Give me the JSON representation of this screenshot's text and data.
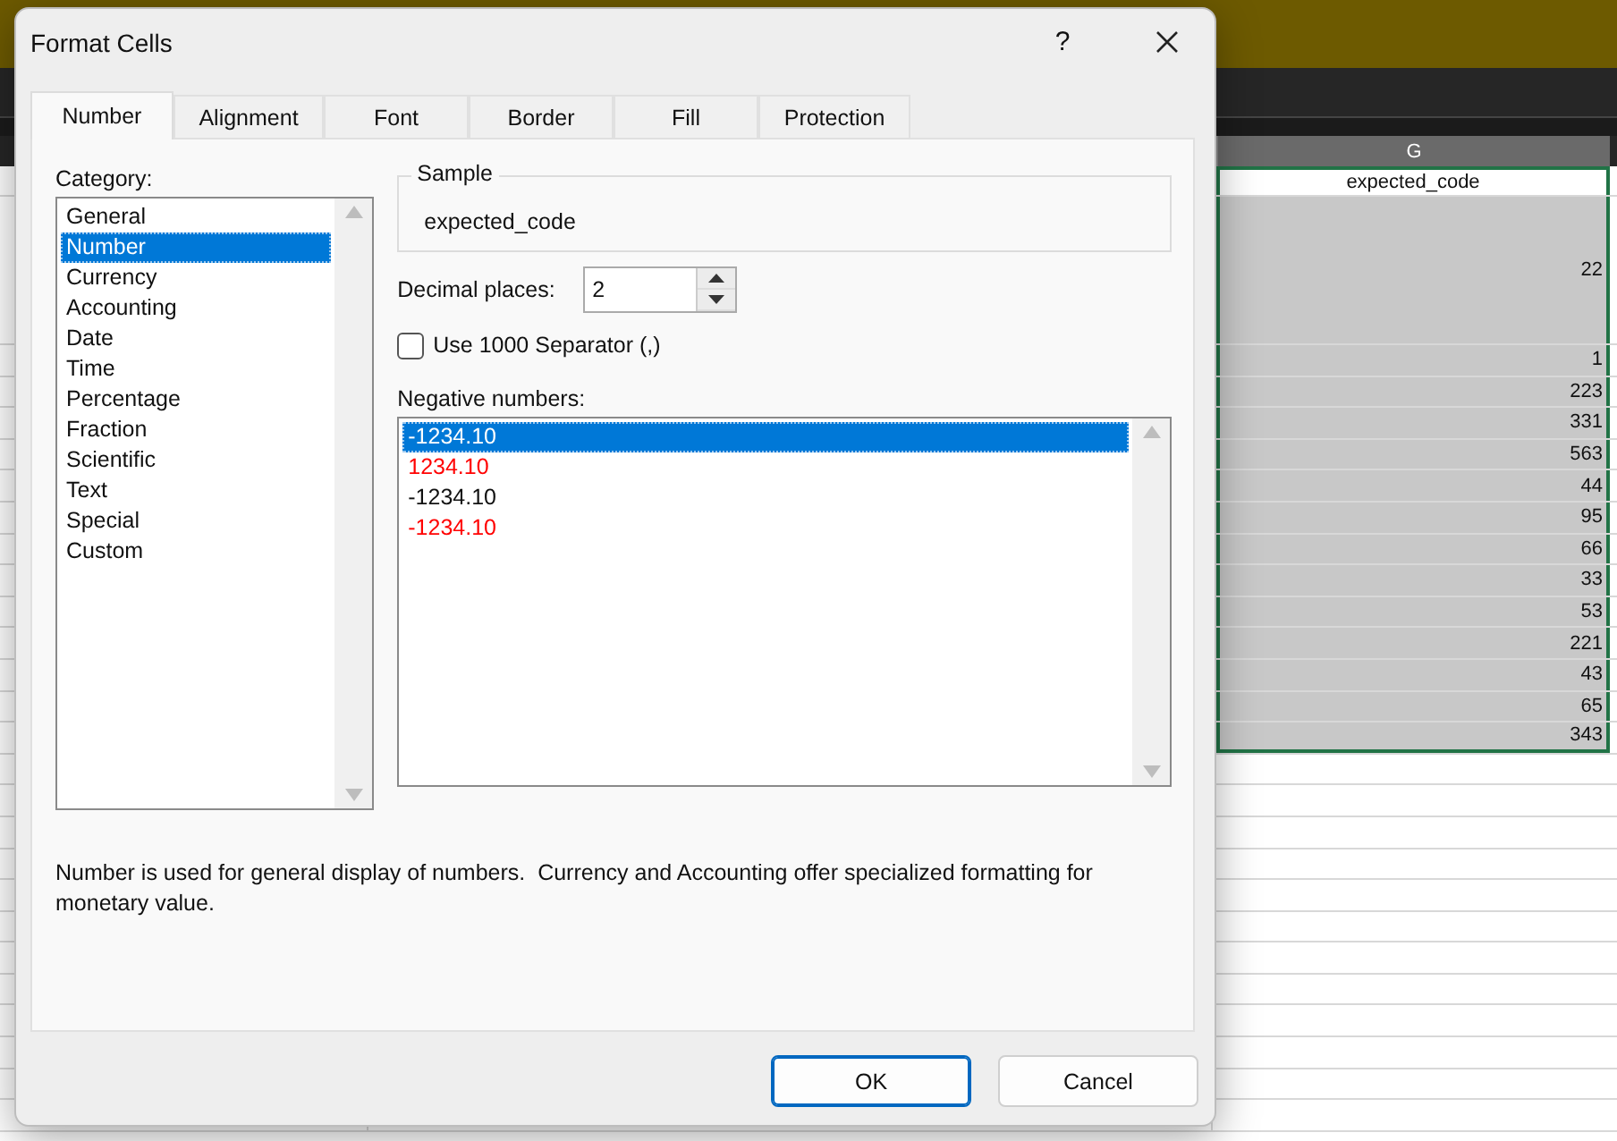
{
  "sheet": {
    "column_header": "G",
    "cells": [
      {
        "text": "expected_code",
        "kind": "text",
        "selected": false
      },
      {
        "text": "22",
        "kind": "number",
        "selected": true
      },
      {
        "text": "1",
        "kind": "number",
        "selected": true
      },
      {
        "text": "223",
        "kind": "number",
        "selected": true
      },
      {
        "text": "331",
        "kind": "number",
        "selected": true
      },
      {
        "text": "563",
        "kind": "number",
        "selected": true
      },
      {
        "text": "44",
        "kind": "number",
        "selected": true
      },
      {
        "text": "95",
        "kind": "number",
        "selected": true
      },
      {
        "text": "66",
        "kind": "number",
        "selected": true
      },
      {
        "text": "33",
        "kind": "number",
        "selected": true
      },
      {
        "text": "53",
        "kind": "number",
        "selected": true
      },
      {
        "text": "221",
        "kind": "number",
        "selected": true
      },
      {
        "text": "43",
        "kind": "number",
        "selected": true
      },
      {
        "text": "65",
        "kind": "number",
        "selected": true
      },
      {
        "text": "343",
        "kind": "number",
        "selected": true
      }
    ]
  },
  "dialog": {
    "title": "Format Cells",
    "help_button": "?",
    "tabs": [
      {
        "label": "Number",
        "selected": true
      },
      {
        "label": "Alignment",
        "selected": false
      },
      {
        "label": "Font",
        "selected": false
      },
      {
        "label": "Border",
        "selected": false
      },
      {
        "label": "Fill",
        "selected": false
      },
      {
        "label": "Protection",
        "selected": false
      }
    ],
    "category": {
      "label": "Category:",
      "items": [
        {
          "label": "General",
          "selected": false
        },
        {
          "label": "Number",
          "selected": true
        },
        {
          "label": "Currency",
          "selected": false
        },
        {
          "label": "Accounting",
          "selected": false
        },
        {
          "label": "Date",
          "selected": false
        },
        {
          "label": "Time",
          "selected": false
        },
        {
          "label": "Percentage",
          "selected": false
        },
        {
          "label": "Fraction",
          "selected": false
        },
        {
          "label": "Scientific",
          "selected": false
        },
        {
          "label": "Text",
          "selected": false
        },
        {
          "label": "Special",
          "selected": false
        },
        {
          "label": "Custom",
          "selected": false
        }
      ]
    },
    "sample": {
      "label": "Sample",
      "value": "expected_code"
    },
    "decimal_places": {
      "label": "Decimal places:",
      "value": "2"
    },
    "separator": {
      "label": "Use 1000 Separator (,)",
      "checked": false
    },
    "negative_numbers": {
      "label": "Negative numbers:",
      "items": [
        {
          "text": "-1234.10",
          "red": false,
          "selected": true
        },
        {
          "text": "1234.10",
          "red": true,
          "selected": false
        },
        {
          "text": "-1234.10",
          "red": false,
          "selected": false
        },
        {
          "text": "-1234.10",
          "red": true,
          "selected": false
        }
      ]
    },
    "description": "Number is used for general display of numbers.  Currency and Accounting offer specialized formatting for monetary value.",
    "buttons": [
      {
        "label": "OK",
        "default": true
      },
      {
        "label": "Cancel",
        "default": false
      }
    ]
  }
}
